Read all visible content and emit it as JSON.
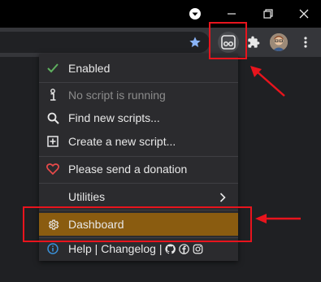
{
  "menu": {
    "enabled_label": "Enabled",
    "no_script_label": "No script is running",
    "find_scripts_label": "Find new scripts...",
    "create_script_label": "Create a new script...",
    "donation_label": "Please send a donation",
    "utilities_label": "Utilities",
    "dashboard_label": "Dashboard",
    "help_label": "Help | Changelog |"
  },
  "icons": {
    "titlebar": [
      "profile-caret-icon",
      "minimize-icon",
      "restore-icon",
      "close-icon"
    ],
    "toolbar": [
      "bookmark-star-icon",
      "tampermonkey-icon",
      "extensions-puzzle-icon",
      "avatar",
      "kebab-menu-icon"
    ],
    "menu": [
      "checkmark-icon",
      "info-i-icon",
      "search-icon",
      "plus-square-icon",
      "heart-icon",
      "chevron-right-icon",
      "gear-icon",
      "info-circle-icon",
      "github-icon",
      "facebook-icon",
      "instagram-icon"
    ]
  },
  "colors": {
    "highlight": "#8a5c10",
    "annotation": "#e8141d",
    "check": "#5fb05f",
    "heart": "#e84a4a",
    "info": "#3a8fd6",
    "star": "#8ab4f8"
  }
}
